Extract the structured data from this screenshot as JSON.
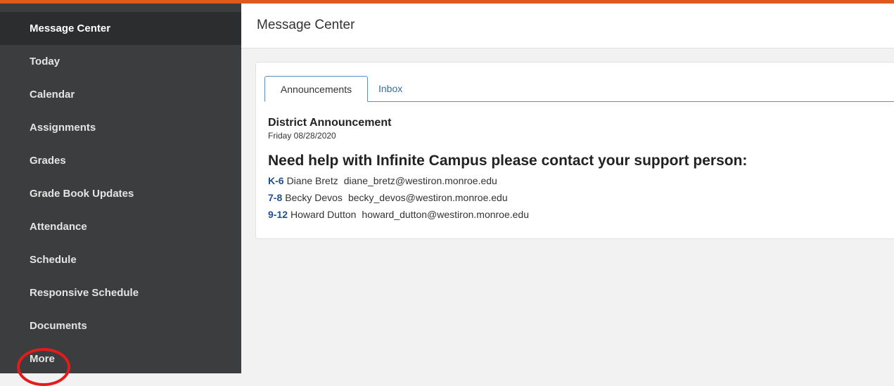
{
  "sidebar": {
    "items": [
      {
        "label": "Message Center",
        "active": true
      },
      {
        "label": "Today"
      },
      {
        "label": "Calendar"
      },
      {
        "label": "Assignments"
      },
      {
        "label": "Grades"
      },
      {
        "label": "Grade Book Updates"
      },
      {
        "label": "Attendance"
      },
      {
        "label": "Schedule"
      },
      {
        "label": "Responsive Schedule"
      },
      {
        "label": "Documents"
      },
      {
        "label": "More"
      }
    ]
  },
  "header": {
    "title": "Message Center"
  },
  "tabs": [
    {
      "label": "Announcements",
      "active": true
    },
    {
      "label": "Inbox",
      "active": false
    }
  ],
  "announcement": {
    "title": "District Announcement",
    "date": "Friday 08/28/2020",
    "heading": "Need help with Infinite Campus please contact your support person:",
    "contacts": [
      {
        "grade": "K-6",
        "name": "Diane Bretz",
        "email": "diane_bretz@westiron.monroe.edu"
      },
      {
        "grade": "7-8",
        "name": "Becky Devos",
        "email": "becky_devos@westiron.monroe.edu"
      },
      {
        "grade": "9-12",
        "name": "Howard Dutton",
        "email": "howard_dutton@westiron.monroe.edu"
      }
    ]
  },
  "colors": {
    "accent_top": "#e05a1e",
    "sidebar_bg": "#3c3d3e",
    "tab_border": "#5b8fc9",
    "link": "#2f6db5",
    "highlight": "#e21b1b"
  }
}
